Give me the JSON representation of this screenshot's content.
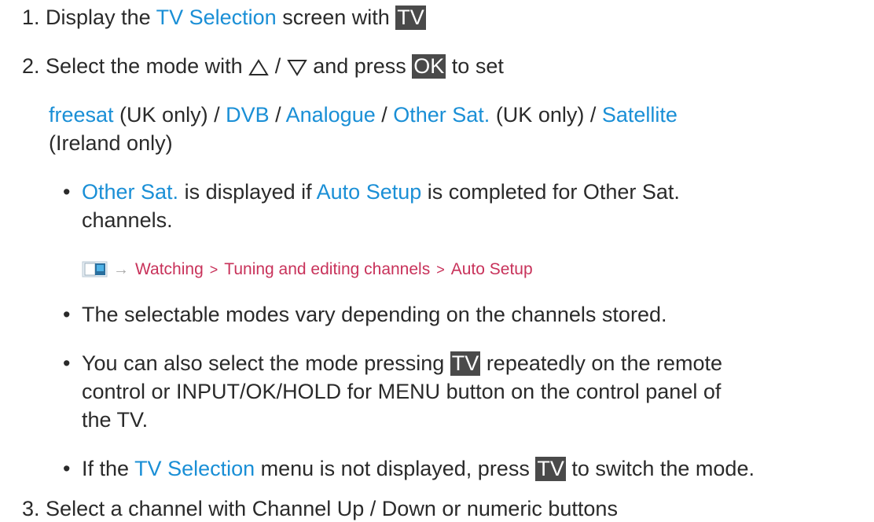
{
  "steps": {
    "s1": {
      "num": "1.",
      "t1": "Display the ",
      "link": "TV Selection",
      "t2": " screen with ",
      "key": "TV"
    },
    "s2": {
      "num": "2.",
      "t1": "Select the mode with ",
      "slash": " / ",
      "t2": " and press ",
      "key": "OK",
      "t3": " to set"
    },
    "s3": {
      "num": "3.",
      "text": "Select a channel with Channel Up / Down or numeric buttons"
    }
  },
  "modes": {
    "freesat": "freesat",
    "uk1": " (UK only) / ",
    "dvb": "DVB",
    "sep1": " / ",
    "analogue": "Analogue",
    "sep2": " / ",
    "other": "Other Sat.",
    "uk2": " (UK only) / ",
    "satellite": "Satellite",
    "ireland": "(Ireland only)"
  },
  "bullets": {
    "b1": {
      "link1": "Other Sat.",
      "t1": " is displayed if ",
      "link2": "Auto Setup",
      "t2": " is completed for Other Sat.",
      "t3": "channels."
    },
    "b2": {
      "text": "The selectable modes vary depending on the channels stored."
    },
    "b3": {
      "t1": "You can also select the mode pressing ",
      "key": "TV",
      "t2": " repeatedly on the remote",
      "t3": "control or INPUT/OK/HOLD for MENU button on the control panel of",
      "t4": "the TV."
    },
    "b4": {
      "t1": "If the ",
      "link": "TV Selection",
      "t2": " menu is not displayed, press ",
      "key": "TV",
      "t3": " to switch the mode."
    }
  },
  "reference": {
    "arrow": "→",
    "items": [
      "Watching",
      "Tuning and editing channels",
      "Auto Setup"
    ],
    "separator": ">"
  },
  "colors": {
    "link": "#1a8fd6",
    "reference": "#c8325a",
    "key_bg": "#4a4a4a"
  }
}
